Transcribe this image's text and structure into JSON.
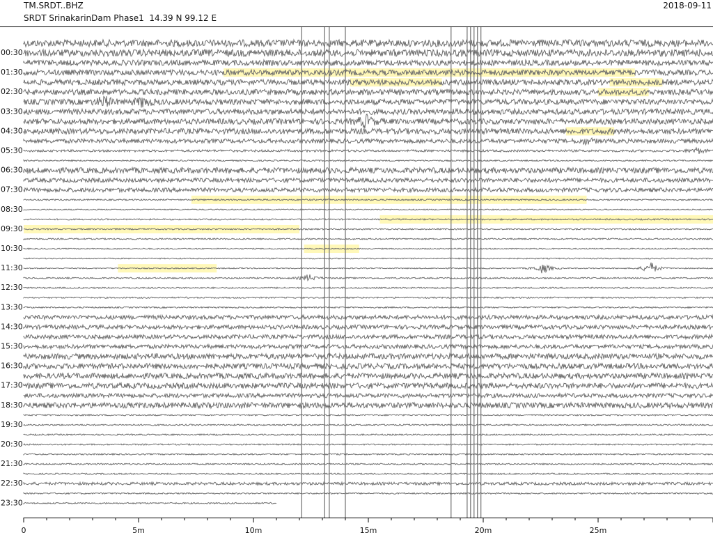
{
  "header": {
    "station": "TM.SRDT..BHZ",
    "subtitle": "SRDT SrinakarinDam Phase1  14.39 N 99.12 E",
    "date": "2018-09-11"
  },
  "colors": {
    "trace": "#6e6e6e",
    "highlight": "#fff8b8",
    "axis": "#000000",
    "background": "#ffffff"
  },
  "chart_data": {
    "type": "helicorder",
    "hour_labels": [
      "00:30",
      "01:30",
      "02:30",
      "03:30",
      "04:30",
      "05:30",
      "06:30",
      "07:30",
      "08:30",
      "09:30",
      "10:30",
      "11:30",
      "12:30",
      "13:30",
      "14:30",
      "15:30",
      "16:30",
      "17:30",
      "18:30",
      "19:30",
      "20:30",
      "21:30",
      "22:30",
      "23:30"
    ],
    "x_ticks": [
      {
        "minute": 0,
        "label": "0"
      },
      {
        "minute": 5,
        "label": "5m"
      },
      {
        "minute": 10,
        "label": "10m"
      },
      {
        "minute": 15,
        "label": "15m"
      },
      {
        "minute": 20,
        "label": "20m"
      },
      {
        "minute": 25,
        "label": "25m"
      }
    ],
    "xlim_minutes": [
      0,
      30
    ],
    "row_interval_minutes": 30,
    "row_count": 48,
    "trace_end": {
      "row": 47,
      "minute": 11.0
    },
    "row_amplitudes": [
      5,
      5,
      4,
      4,
      4,
      4,
      4,
      4,
      4,
      4,
      3,
      1.6,
      1,
      4,
      3,
      3,
      1,
      0.8,
      1,
      1,
      1,
      0.8,
      0.8,
      0.8,
      1,
      1,
      1,
      1,
      3,
      3,
      3,
      3,
      4,
      4,
      4,
      4,
      3,
      4,
      1,
      1,
      1,
      1,
      1,
      1,
      1,
      2,
      1,
      1
    ],
    "highlights": [
      {
        "row": 3,
        "start_min": 8.7,
        "end_min": 26.6
      },
      {
        "row": 4,
        "start_min": 14.2,
        "end_min": 18.2
      },
      {
        "row": 4,
        "start_min": 25.5,
        "end_min": 27.8
      },
      {
        "row": 5,
        "start_min": 25.0,
        "end_min": 27.2
      },
      {
        "row": 9,
        "start_min": 23.6,
        "end_min": 25.7
      },
      {
        "row": 16,
        "start_min": 7.3,
        "end_min": 24.5
      },
      {
        "row": 18,
        "start_min": 15.5,
        "end_min": 30.0
      },
      {
        "row": 19,
        "start_min": 0.0,
        "end_min": 12.0
      },
      {
        "row": 21,
        "start_min": 12.2,
        "end_min": 14.6
      },
      {
        "row": 23,
        "start_min": 4.1,
        "end_min": 8.4
      }
    ],
    "events": [
      {
        "row": 6,
        "minute": 3.5,
        "amplitude": 2.5
      },
      {
        "row": 6,
        "minute": 5.2,
        "amplitude": 2.2
      },
      {
        "row": 8,
        "minute": 14.9,
        "amplitude": 2.8
      },
      {
        "row": 10,
        "minute": 24.5,
        "amplitude": 1.2
      },
      {
        "row": 11,
        "minute": 29.3,
        "amplitude": 1.4
      },
      {
        "row": 23,
        "minute": 22.6,
        "amplitude": 2.6
      },
      {
        "row": 23,
        "minute": 27.3,
        "amplitude": 3.0
      },
      {
        "row": 24,
        "minute": 12.4,
        "amplitude": 1.8
      }
    ],
    "spike_minutes": [
      12.1,
      13.1,
      13.3,
      14.0,
      18.6,
      19.3,
      19.45,
      19.6,
      19.75,
      19.9
    ],
    "grid": false
  }
}
